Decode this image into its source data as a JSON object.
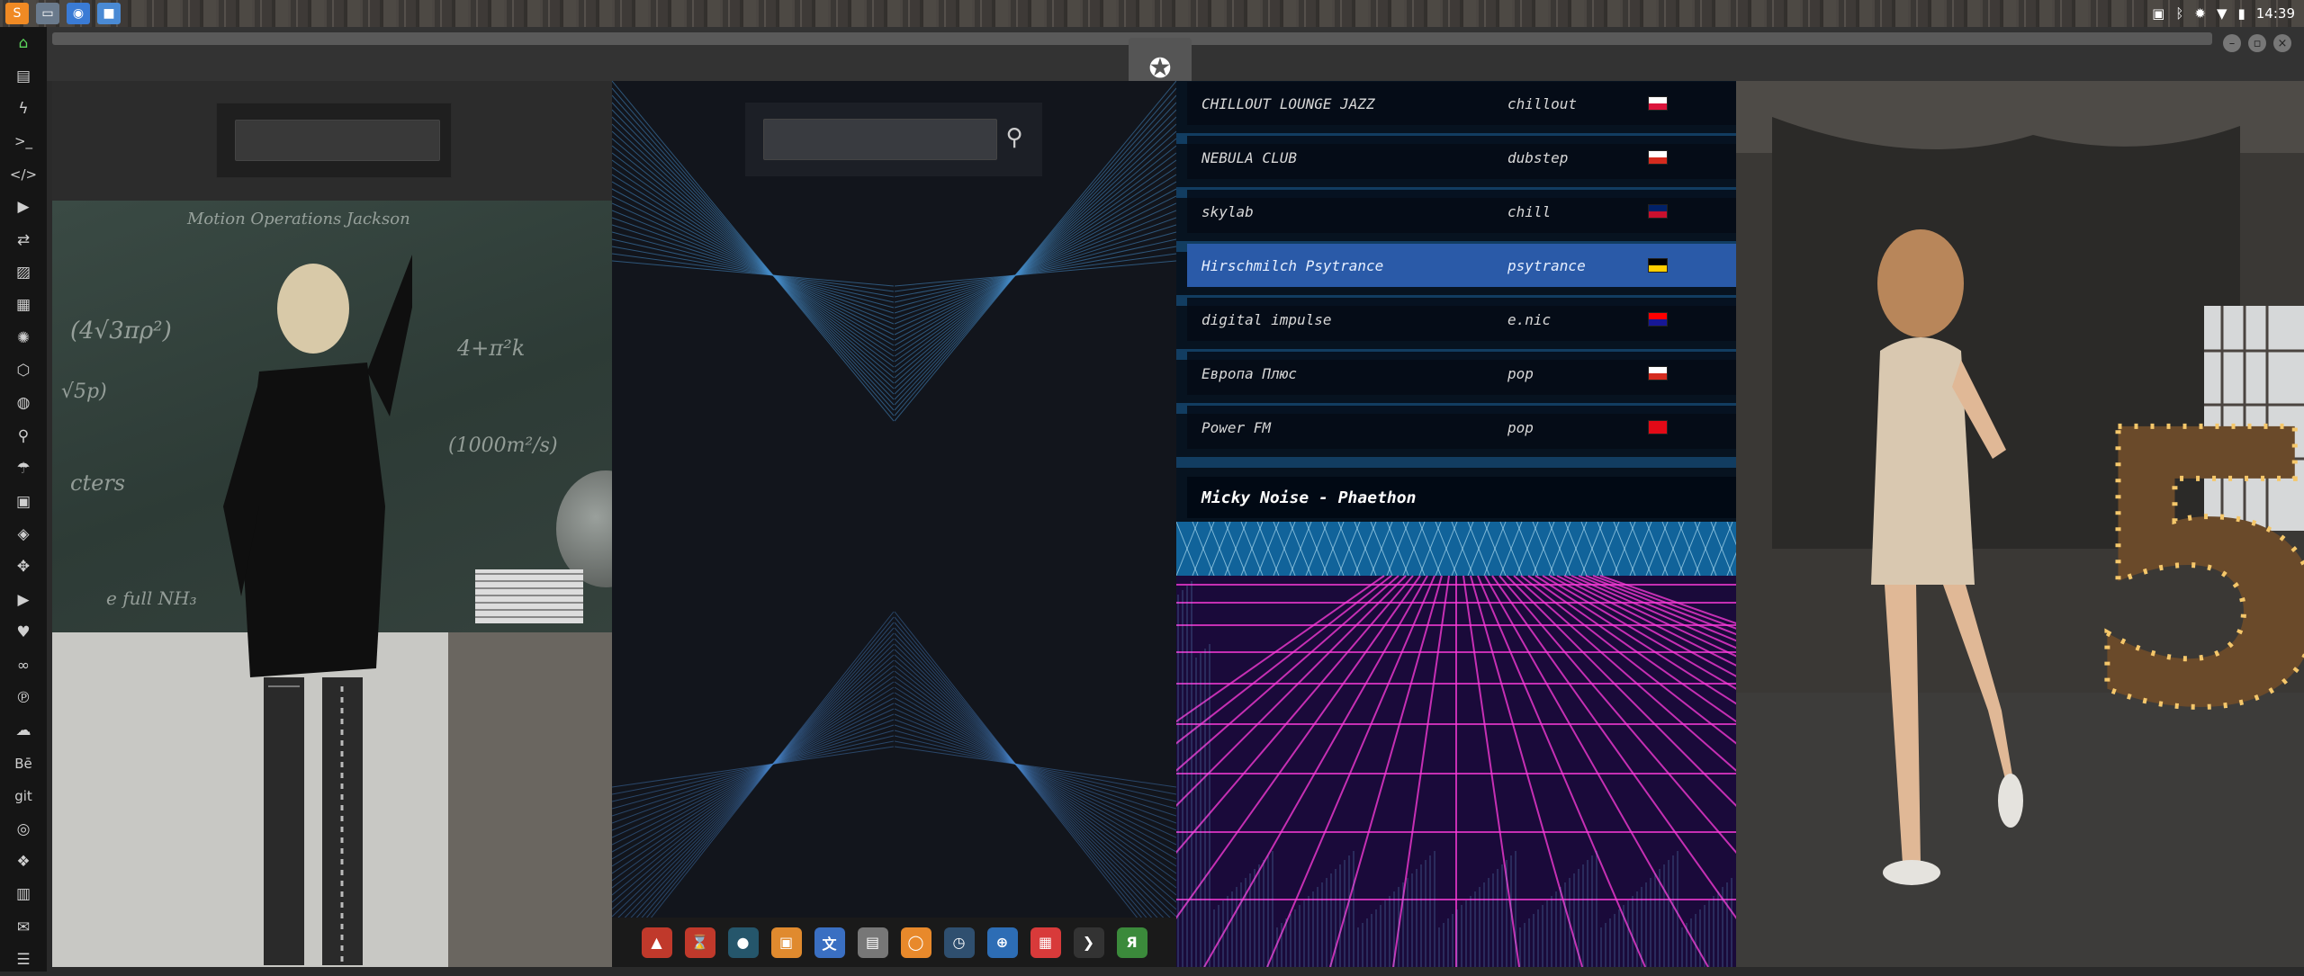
{
  "topbar": {
    "apps": [
      {
        "name": "sublime-app-icon",
        "glyph": "S",
        "color": "#f08a24"
      },
      {
        "name": "files-app-icon",
        "glyph": "▭",
        "color": "#6a7a8c"
      },
      {
        "name": "chrome-app-icon",
        "glyph": "◉",
        "color": "#3a7bd5"
      },
      {
        "name": "folder-app-icon",
        "glyph": "■",
        "color": "#4a8ad4"
      }
    ],
    "tray_icons": [
      {
        "name": "image-tray-icon",
        "glyph": "▣"
      },
      {
        "name": "bluetooth-icon",
        "glyph": "ᛒ"
      },
      {
        "name": "bug-tray-icon",
        "glyph": "✹"
      },
      {
        "name": "wifi-icon",
        "glyph": "▼"
      },
      {
        "name": "battery-icon",
        "glyph": "▮"
      }
    ],
    "clock": "14:39"
  },
  "sidebar": {
    "items": [
      {
        "name": "home-icon",
        "glyph": "⌂"
      },
      {
        "name": "document-icon",
        "glyph": "▤"
      },
      {
        "name": "lightning-icon",
        "glyph": "ϟ"
      },
      {
        "name": "terminal-icon",
        "glyph": ">_"
      },
      {
        "name": "code-icon",
        "glyph": "</>"
      },
      {
        "name": "play-icon",
        "glyph": "▶"
      },
      {
        "name": "translate-icon",
        "glyph": "⇄"
      },
      {
        "name": "image-icon",
        "glyph": "▨"
      },
      {
        "name": "newspaper-icon",
        "glyph": "▦"
      },
      {
        "name": "aperture-icon",
        "glyph": "✺"
      },
      {
        "name": "hexagon-icon",
        "glyph": "⬡"
      },
      {
        "name": "globe-icon",
        "glyph": "◍"
      },
      {
        "name": "search-icon",
        "glyph": "⚲"
      },
      {
        "name": "umbrella-icon",
        "glyph": "☂"
      },
      {
        "name": "contact-icon",
        "glyph": "▣"
      },
      {
        "name": "tag-icon",
        "glyph": "◈"
      },
      {
        "name": "expand-icon",
        "glyph": "✥"
      },
      {
        "name": "youtube-icon",
        "glyph": "▶"
      },
      {
        "name": "heart-icon",
        "glyph": "♥"
      },
      {
        "name": "link-icon",
        "glyph": "∞"
      },
      {
        "name": "pinterest-icon",
        "glyph": "℗"
      },
      {
        "name": "cloud-icon",
        "glyph": "☁"
      },
      {
        "name": "behance-icon",
        "glyph": "Bē"
      },
      {
        "name": "git-icon",
        "glyph": "git"
      },
      {
        "name": "github-icon",
        "glyph": "◎"
      },
      {
        "name": "cubes-icon",
        "glyph": "❖"
      },
      {
        "name": "map-icon",
        "glyph": "▥"
      },
      {
        "name": "mail-icon",
        "glyph": "✉"
      },
      {
        "name": "server-icon",
        "glyph": "☰"
      }
    ]
  },
  "titlebar": {
    "emblem_glyph": "✪",
    "window_buttons": [
      {
        "name": "minimize-button",
        "glyph": "–"
      },
      {
        "name": "maximize-button",
        "glyph": "▫"
      },
      {
        "name": "close-button",
        "glyph": "×"
      }
    ]
  },
  "panel1": {
    "search": {
      "value": ""
    }
  },
  "panel2": {
    "search": {
      "value": ""
    },
    "search_icon_glyph": "⚲",
    "dock": [
      {
        "name": "dock-warning-icon",
        "glyph": "▲",
        "bg": "#c0392b"
      },
      {
        "name": "dock-hourglass-icon",
        "glyph": "⌛",
        "bg": "#c0392b"
      },
      {
        "name": "dock-earth-icon",
        "glyph": "●",
        "bg": "#25566b"
      },
      {
        "name": "dock-photos-icon",
        "glyph": "▣",
        "bg": "#e08a2e"
      },
      {
        "name": "dock-translate-icon",
        "glyph": "文",
        "bg": "#3a6fc2"
      },
      {
        "name": "dock-browser-icon",
        "glyph": "▤",
        "bg": "#777777"
      },
      {
        "name": "dock-search-icon",
        "glyph": "◯",
        "bg": "#e8892b"
      },
      {
        "name": "dock-clock-icon",
        "glyph": "◷",
        "bg": "#2f4f6f"
      },
      {
        "name": "dock-globe-icon",
        "glyph": "⊕",
        "bg": "#2d6db5"
      },
      {
        "name": "dock-calendar-icon",
        "glyph": "▦",
        "bg": "#d83a3a"
      },
      {
        "name": "dock-sublime-icon",
        "glyph": "❯",
        "bg": "#333333"
      },
      {
        "name": "dock-yandex-icon",
        "glyph": "Я",
        "bg": "#3b8a3b"
      }
    ]
  },
  "radio": {
    "stations": [
      {
        "name": "CHILLOUT LOUNGE JAZZ",
        "genre": "chillout",
        "flag_top": "#ffffff",
        "flag_bottom": "#dc143c",
        "selected": false
      },
      {
        "name": "NEBULA CLUB",
        "genre": "dubstep",
        "flag_top": "#ffffff",
        "flag_bottom": "#d52b1e",
        "selected": false
      },
      {
        "name": "skylab",
        "genre": "chill",
        "flag_top": "#012169",
        "flag_bottom": "#c8102e",
        "selected": false
      },
      {
        "name": "Hirschmilch Psytrance",
        "genre": "psytrance",
        "flag_top": "#000000",
        "flag_bottom": "#ffce00",
        "selected": true
      },
      {
        "name": "digital impulse",
        "genre": "e.nic",
        "flag_top": "#ff0000",
        "flag_bottom": "#171796",
        "selected": false
      },
      {
        "name": "Европа Плюс",
        "genre": "pop",
        "flag_top": "#ffffff",
        "flag_bottom": "#d52b1e",
        "selected": false
      },
      {
        "name": "Power FM",
        "genre": "pop",
        "flag_top": "#e30a17",
        "flag_bottom": "#e30a17",
        "selected": false
      }
    ],
    "now_playing": "Micky Noise - Phaethon"
  }
}
